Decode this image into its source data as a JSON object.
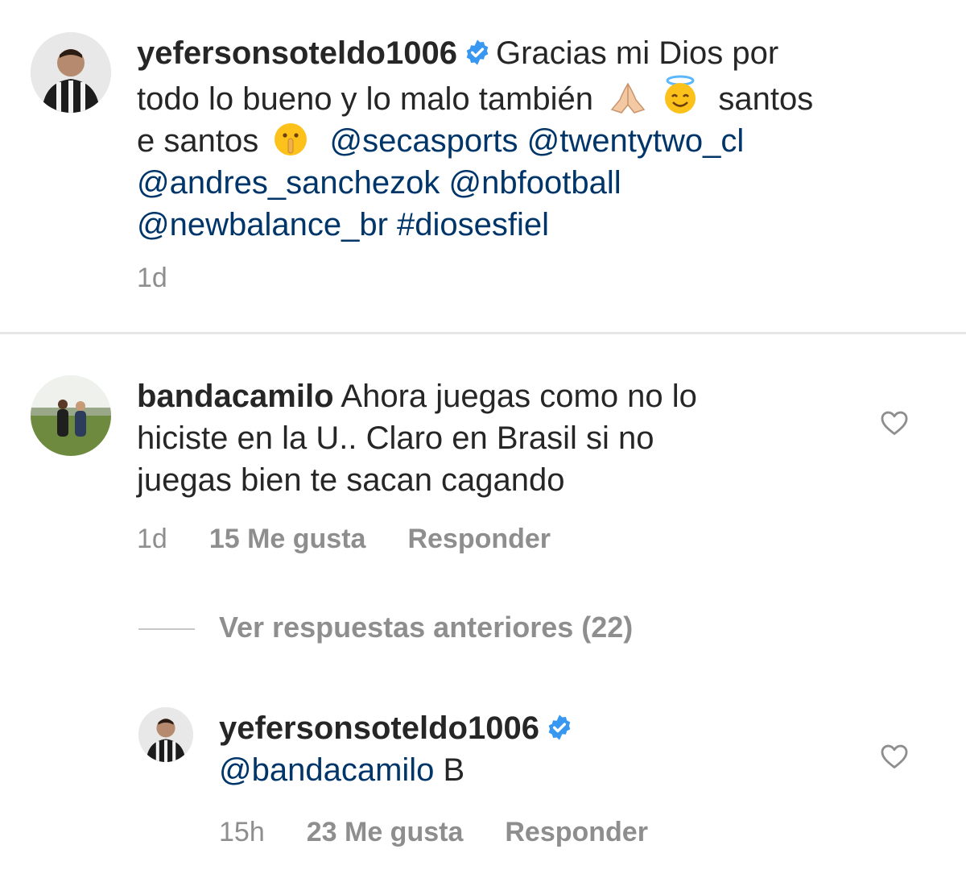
{
  "post": {
    "username": "yefersonsoteldo1006",
    "caption_1": "Gracias mi Dios por",
    "caption_2": "todo lo bueno y lo malo también",
    "caption_3": "santos",
    "caption_4": "e santos",
    "mention_1": "@secasports",
    "mention_2": "@twentytwo_cl",
    "mention_3": "@andres_sanchezok",
    "mention_4": "@nbfootball",
    "mention_5": "@newbalance_br",
    "hashtag": "#diosesfiel",
    "time": "1d"
  },
  "comment": {
    "username": "bandacamilo",
    "text_1": "Ahora juegas como no lo",
    "text_2": "hiciste en la U.. Claro en Brasil si no",
    "text_3": "juegas bien te sacan cagando",
    "time": "1d",
    "likes": "15 Me gusta",
    "reply": "Responder"
  },
  "view_replies": "Ver respuestas anteriores (22)",
  "reply": {
    "username": "yefersonsoteldo1006",
    "mention": "@bandacamilo",
    "text": "B",
    "time": "15h",
    "likes": "23 Me gusta",
    "reply": "Responder"
  },
  "icons": {
    "verified": "verified-badge-icon",
    "heart": "heart-outline-icon",
    "emojis": [
      "folded-hands-emoji",
      "smiling-face-with-halo-emoji",
      "shushing-face-emoji"
    ]
  },
  "colors": {
    "mention": "#003569",
    "verified": "#3897f0",
    "meta": "#8e8e8e"
  }
}
